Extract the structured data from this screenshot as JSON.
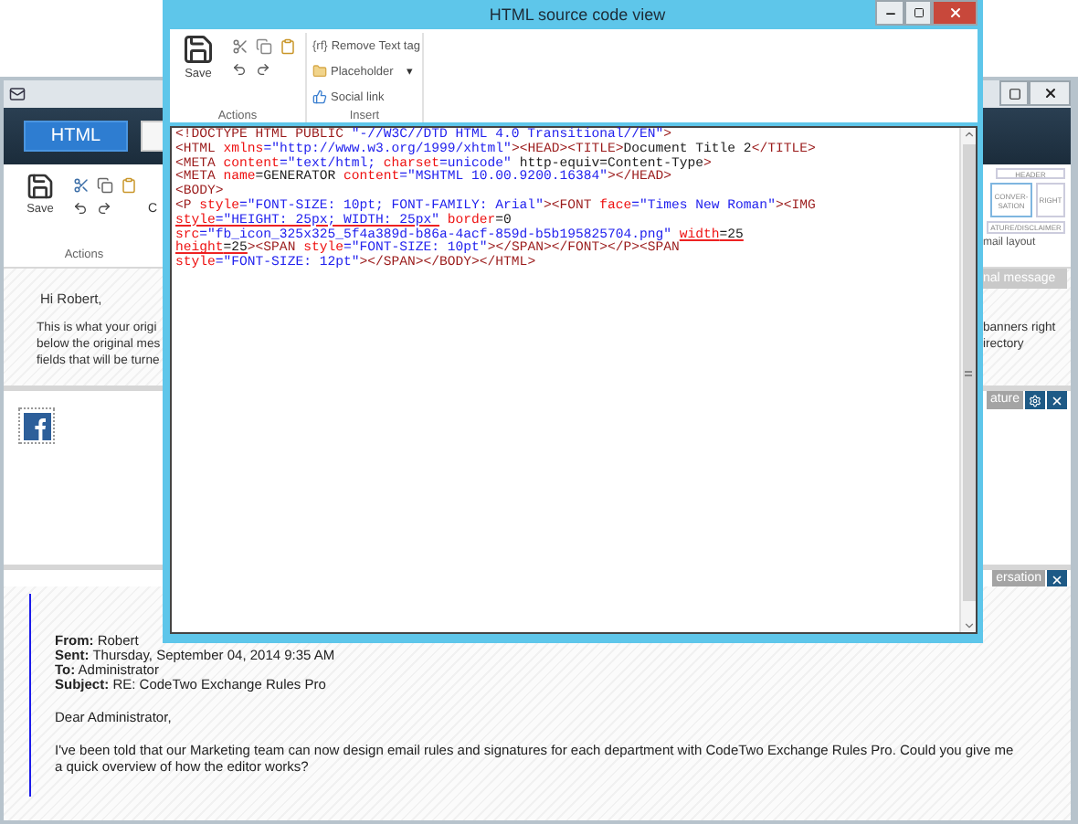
{
  "app": {
    "tabs": [
      {
        "label": "HTML",
        "selected": true
      },
      {
        "selected": false
      }
    ],
    "toolbar": {
      "save": "Save",
      "cut_label": "C",
      "group": "Actions"
    },
    "layouts": [
      {
        "lines": [
          "HEADER"
        ],
        "selected": false
      },
      {
        "lines": [
          "CONVER-",
          "SATION"
        ],
        "selected": true
      },
      {
        "lines": [
          "RIGHT"
        ],
        "selected": false
      },
      {
        "lines": [
          "ATURE/DISCLAIMER"
        ],
        "selected": false
      }
    ],
    "layout_caption": "mail layout",
    "message_button": "nal message",
    "greeting": "Hi Robert,",
    "intro_lines": [
      {
        "left": "This is what your origi",
        "right": "banners right"
      },
      {
        "left": "below the original mes",
        "right": "irectory"
      },
      {
        "left": "fields that will be turne"
      }
    ],
    "section_bars": [
      {
        "label": "ature",
        "settings": true
      },
      {
        "label": "ersation",
        "settings": false
      }
    ],
    "quote": {
      "headers": [
        {
          "label": "From:",
          "value": "Robert"
        },
        {
          "label": "Sent:",
          "value": "Thursday, September 04, 2014 9:35 AM"
        },
        {
          "label": "To:",
          "value": "Administrator"
        },
        {
          "label": "Subject:",
          "value": "RE: CodeTwo Exchange Rules Pro"
        }
      ],
      "salutation": "Dear Administrator,",
      "body": "I've been told that our Marketing team can now design email rules and signatures for each department with CodeTwo Exchange Rules Pro. Could you give me a quick overview of how the editor works?"
    }
  },
  "dialog": {
    "title": "HTML source code view",
    "actions": {
      "save": "Save",
      "label": "Actions"
    },
    "insert": {
      "label": "Insert",
      "items": [
        {
          "kind": "text_tag",
          "icon_text": "{rf}",
          "label": "Remove Text tag"
        },
        {
          "kind": "placeholder",
          "label": "Placeholder",
          "caret": "▾"
        },
        {
          "kind": "social",
          "label": "Social link"
        }
      ]
    },
    "code_lines": [
      [
        {
          "kind": "tag",
          "text": "<!DOCTYPE HTML PUBLIC "
        },
        {
          "kind": "value",
          "text": "\"-//W3C//DTD HTML 4.0 Transitional//EN\""
        },
        {
          "kind": "tag",
          "text": ">"
        }
      ],
      [
        {
          "kind": "tag",
          "text": "<HTML "
        },
        {
          "kind": "attr",
          "text": "xmlns"
        },
        {
          "kind": "value",
          "text": "=\"http://www.w3.org/1999/xhtml\""
        },
        {
          "kind": "tag",
          "text": "><HEAD><TITLE>"
        },
        {
          "kind": "text",
          "text": "Document Title 2"
        },
        {
          "kind": "tag",
          "text": "</TITLE>"
        }
      ],
      [
        {
          "kind": "tag",
          "text": "<META "
        },
        {
          "kind": "attr",
          "text": "content"
        },
        {
          "kind": "value",
          "text": "=\"text/html; "
        },
        {
          "kind": "attr",
          "text": "charset"
        },
        {
          "kind": "value",
          "text": "=unicode\""
        },
        {
          "kind": "text",
          "text": " http-equiv=Content-Type"
        },
        {
          "kind": "tag",
          "text": ">"
        }
      ],
      [
        {
          "kind": "tag",
          "text": "<META "
        },
        {
          "kind": "attr",
          "text": "name"
        },
        {
          "kind": "text",
          "text": "=GENERATOR "
        },
        {
          "kind": "attr",
          "text": "content"
        },
        {
          "kind": "value",
          "text": "=\"MSHTML 10.00.9200.16384\""
        },
        {
          "kind": "tag",
          "text": "></HEAD>"
        }
      ],
      [
        {
          "kind": "tag",
          "text": "<BODY>"
        }
      ],
      [
        {
          "kind": "tag",
          "text": "<P "
        },
        {
          "kind": "attr",
          "text": "style"
        },
        {
          "kind": "value",
          "text": "=\"FONT-SIZE: 10pt; FONT-FAMILY: Arial\""
        },
        {
          "kind": "tag",
          "text": "><FONT "
        },
        {
          "kind": "attr",
          "text": "face"
        },
        {
          "kind": "value",
          "text": "=\"Times New Roman\""
        },
        {
          "kind": "tag",
          "text": "><IMG"
        }
      ],
      [
        {
          "kind": "attr",
          "text": "style",
          "flagged": true
        },
        {
          "kind": "value",
          "text": "=\"HEIGHT: 25px; WIDTH: 25px\"",
          "flagged": true
        },
        {
          "kind": "attr",
          "text": " border"
        },
        {
          "kind": "text",
          "text": "=0"
        }
      ],
      [
        {
          "kind": "attr",
          "text": "src"
        },
        {
          "kind": "value",
          "text": "=\"fb_icon_325x325_5f4a389d-b86a-4acf-859d-b5b195825704.png\" "
        },
        {
          "kind": "attr",
          "text": "width",
          "flagged": true
        },
        {
          "kind": "text",
          "text": "=25",
          "flagged": true
        }
      ],
      [
        {
          "kind": "attr",
          "text": "height",
          "flagged": true
        },
        {
          "kind": "text",
          "text": "=25",
          "flagged": true
        },
        {
          "kind": "tag",
          "text": "><SPAN "
        },
        {
          "kind": "attr",
          "text": "style"
        },
        {
          "kind": "value",
          "text": "=\"FONT-SIZE: 10pt\""
        },
        {
          "kind": "tag",
          "text": "></SPAN></FONT></P><SPAN"
        }
      ],
      [
        {
          "kind": "attr",
          "text": "style"
        },
        {
          "kind": "value",
          "text": "=\"FONT-SIZE: 12pt\""
        },
        {
          "kind": "tag",
          "text": "></SPAN></BODY></HTML>"
        }
      ]
    ]
  }
}
